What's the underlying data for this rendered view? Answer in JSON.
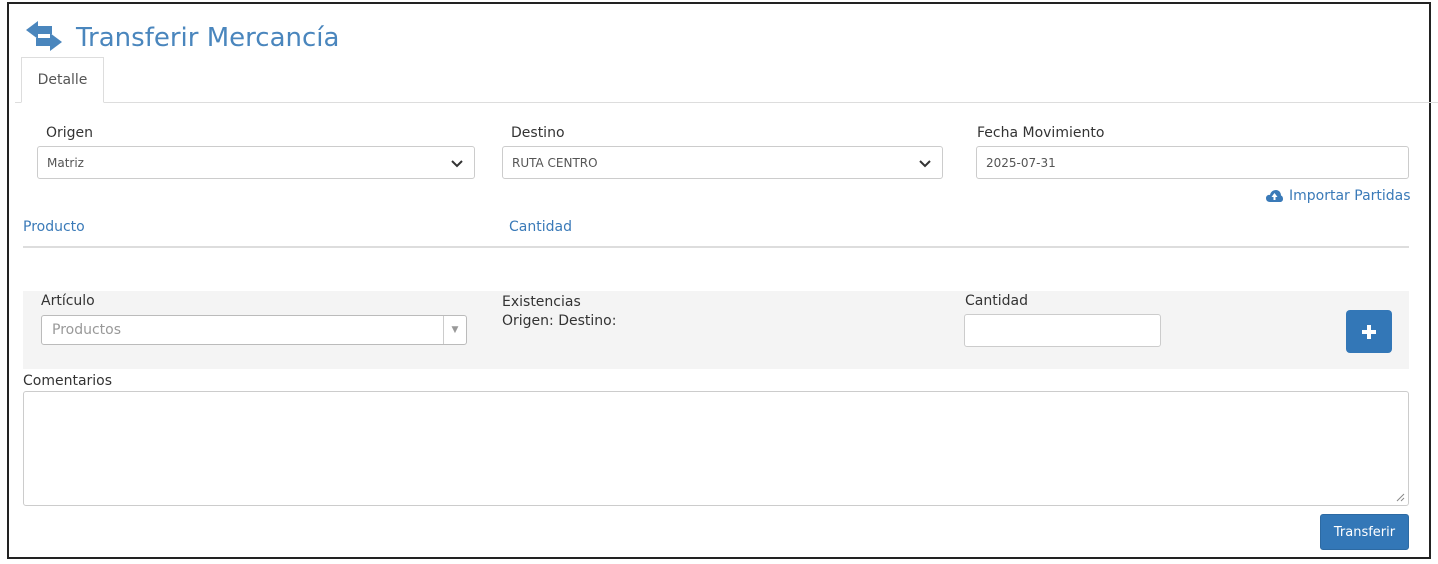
{
  "header": {
    "title": "Transferir Mercancía",
    "icon": "exchange-arrows-icon",
    "accent": "#4a86bd"
  },
  "tabs": [
    {
      "label": "Detalle",
      "active": true
    }
  ],
  "form": {
    "origen": {
      "label": "Origen",
      "value": "Matriz"
    },
    "destino": {
      "label": "Destino",
      "value": "RUTA CENTRO"
    },
    "fecha": {
      "label": "Fecha Movimiento",
      "value": "2025-07-31"
    },
    "import_link": "Importar Partidas"
  },
  "table": {
    "columns": [
      "Producto",
      "Cantidad"
    ]
  },
  "add_item": {
    "articulo_label": "Artículo",
    "articulo_placeholder": "Productos",
    "existencias_label": "Existencias",
    "existencias_values": "Origen: Destino:",
    "cantidad_label": "Cantidad",
    "cantidad_value": "",
    "add_icon": "plus-icon"
  },
  "comments": {
    "label": "Comentarios",
    "value": ""
  },
  "actions": {
    "submit": "Transferir"
  },
  "colors": {
    "primary": "#3377b7",
    "link": "#3a7ab8"
  }
}
